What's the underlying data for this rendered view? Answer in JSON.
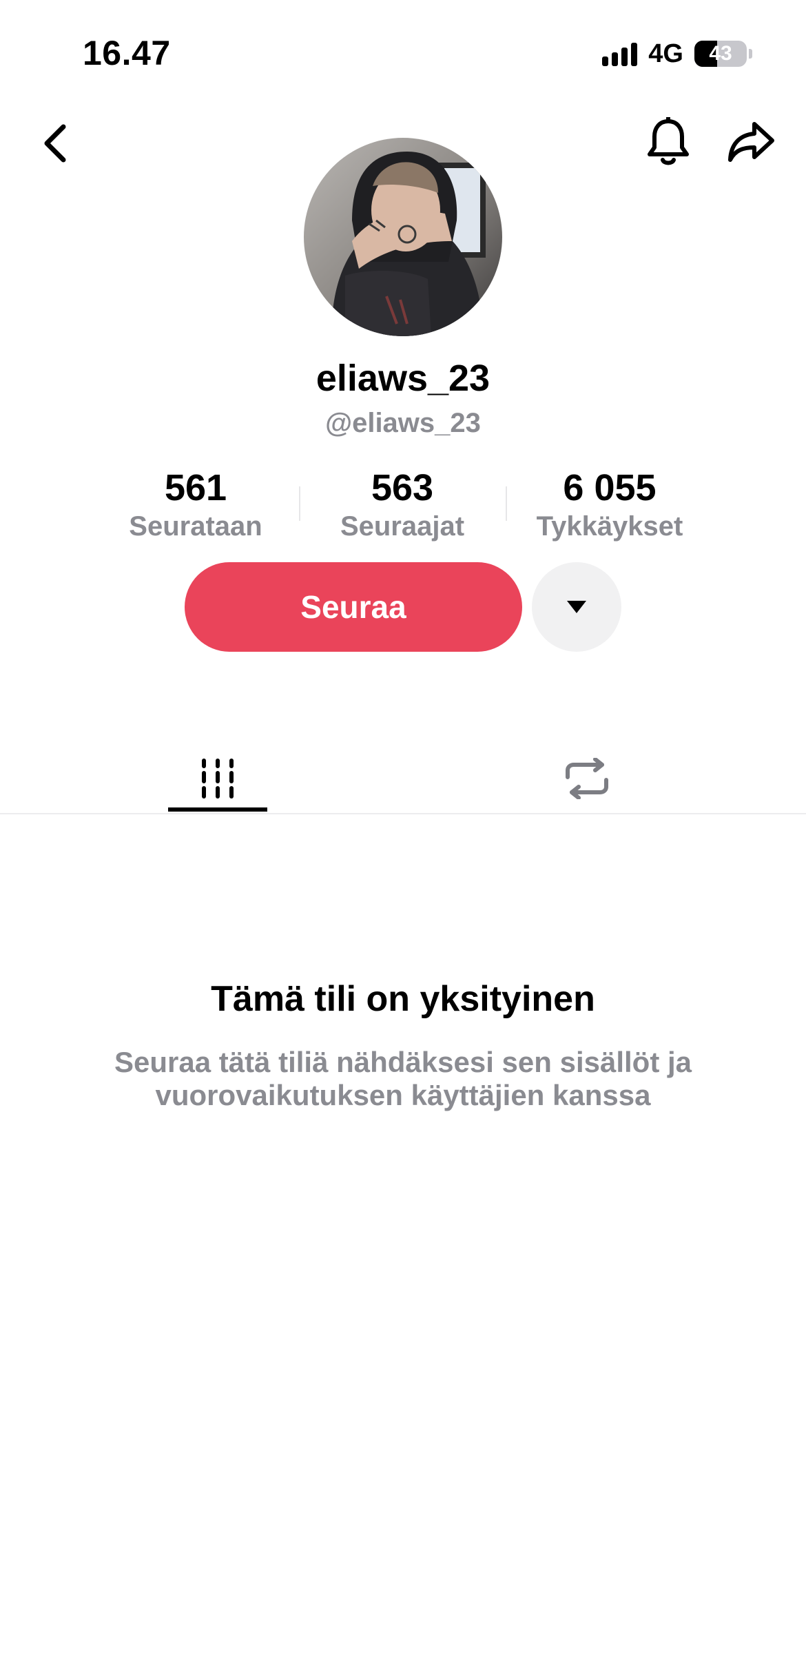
{
  "status_bar": {
    "time": "16.47",
    "network": "4G",
    "battery_level": "43"
  },
  "nav": {
    "back_icon": "chevron-left-icon",
    "bell_icon": "bell-icon",
    "share_icon": "share-arrow-icon"
  },
  "profile": {
    "display_name": "eliaws_23",
    "handle": "@eliaws_23"
  },
  "stats": [
    {
      "value": "561",
      "label": "Seurataan"
    },
    {
      "value": "563",
      "label": "Seuraajat"
    },
    {
      "value": "6 055",
      "label": "Tykkäykset"
    }
  ],
  "actions": {
    "follow_label": "Seuraa",
    "more_icon": "caret-down-icon"
  },
  "tabs": [
    {
      "icon": "grid-icon",
      "active": true
    },
    {
      "icon": "repost-icon",
      "active": false
    }
  ],
  "private_notice": {
    "title": "Tämä tili on yksityinen",
    "description": "Seuraa tätä tiliä nähdäksesi sen sisällöt ja vuorovaikutuksen käyttäjien kanssa"
  },
  "colors": {
    "follow_button": "#ea445a",
    "secondary_text": "#8a8b91"
  }
}
